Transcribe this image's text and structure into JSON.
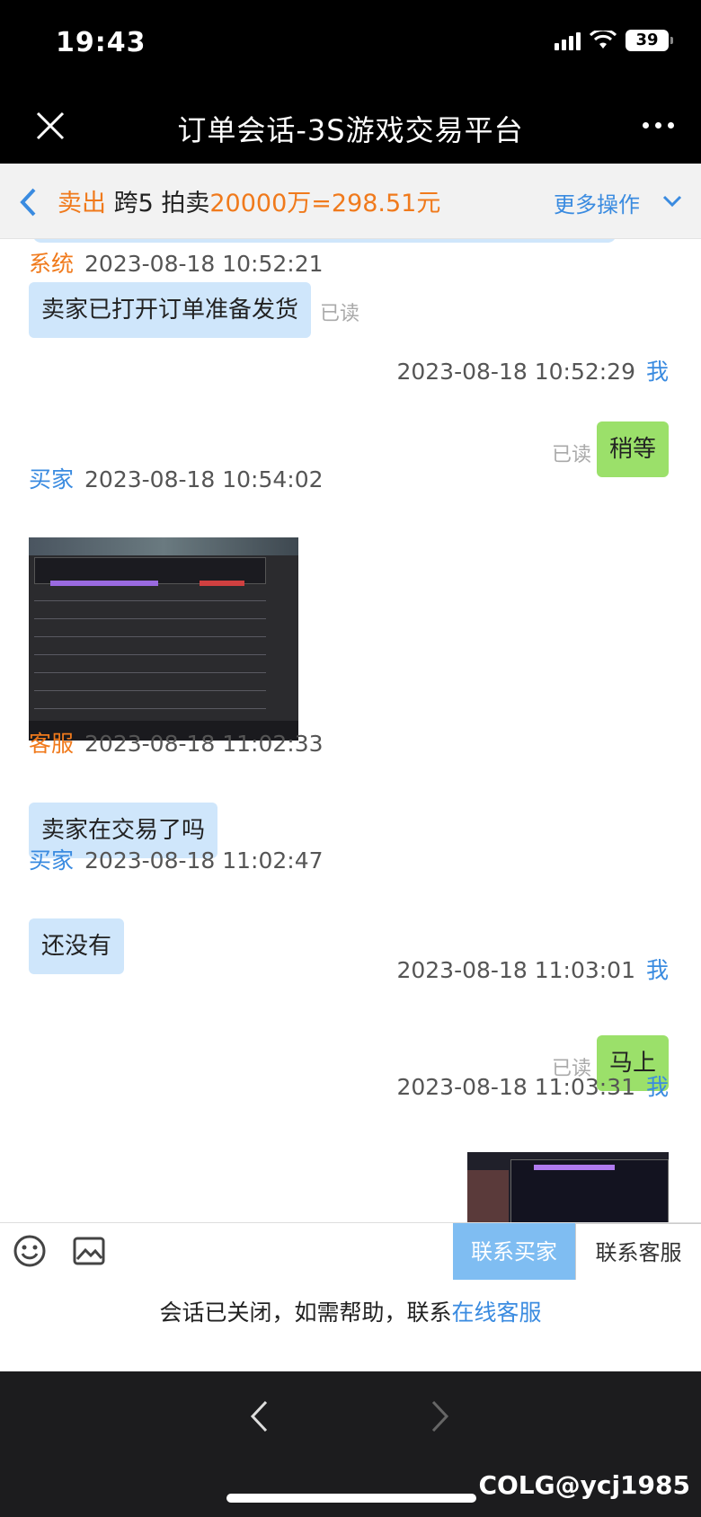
{
  "status_bar": {
    "time": "19:43",
    "battery": "39"
  },
  "title_bar": {
    "title": "订单会话-3S游戏交易平台"
  },
  "order_bar": {
    "type": "卖出",
    "server": "跨5",
    "mode": "拍卖",
    "price": "20000万=298.51元",
    "more_ops": "更多操作"
  },
  "messages": [
    {
      "role": "系统",
      "time": "2023-08-18 10:52:21",
      "text": "卖家已打开订单准备发货",
      "read": "已读"
    },
    {
      "role": "",
      "time": "2023-08-18 10:52:29",
      "me": "我",
      "text": "稍等",
      "read": "已读"
    },
    {
      "role": "买家",
      "time": "2023-08-18 10:54:02"
    },
    {
      "role": "客服",
      "time": "2023-08-18 11:02:33",
      "text": "卖家在交易了吗"
    },
    {
      "role": "买家",
      "time": "2023-08-18 11:02:47",
      "text": "还没有"
    },
    {
      "role": "",
      "time": "2023-08-18 11:03:01",
      "me": "我",
      "text": "马上",
      "read": "已读"
    },
    {
      "role": "",
      "time": "2023-08-18 11:03:31",
      "me": "我"
    }
  ],
  "input_bar": {
    "contact_buyer": "联系买家",
    "contact_cs": "联系客服"
  },
  "closed_note": {
    "text": "会话已关闭，如需帮助，联系",
    "link": "在线客服"
  },
  "watermark": "COLG@ycj1985",
  "colors": {
    "accent_blue": "#3a8be0",
    "orange": "#f07a1c",
    "bubble_blue": "#cfe6fb",
    "bubble_green": "#9be06a"
  },
  "icons": [
    "close-icon",
    "more-icon",
    "back-arrow-icon",
    "chevron-down-icon",
    "emoji-icon",
    "image-icon",
    "nav-back-icon",
    "nav-forward-icon"
  ]
}
